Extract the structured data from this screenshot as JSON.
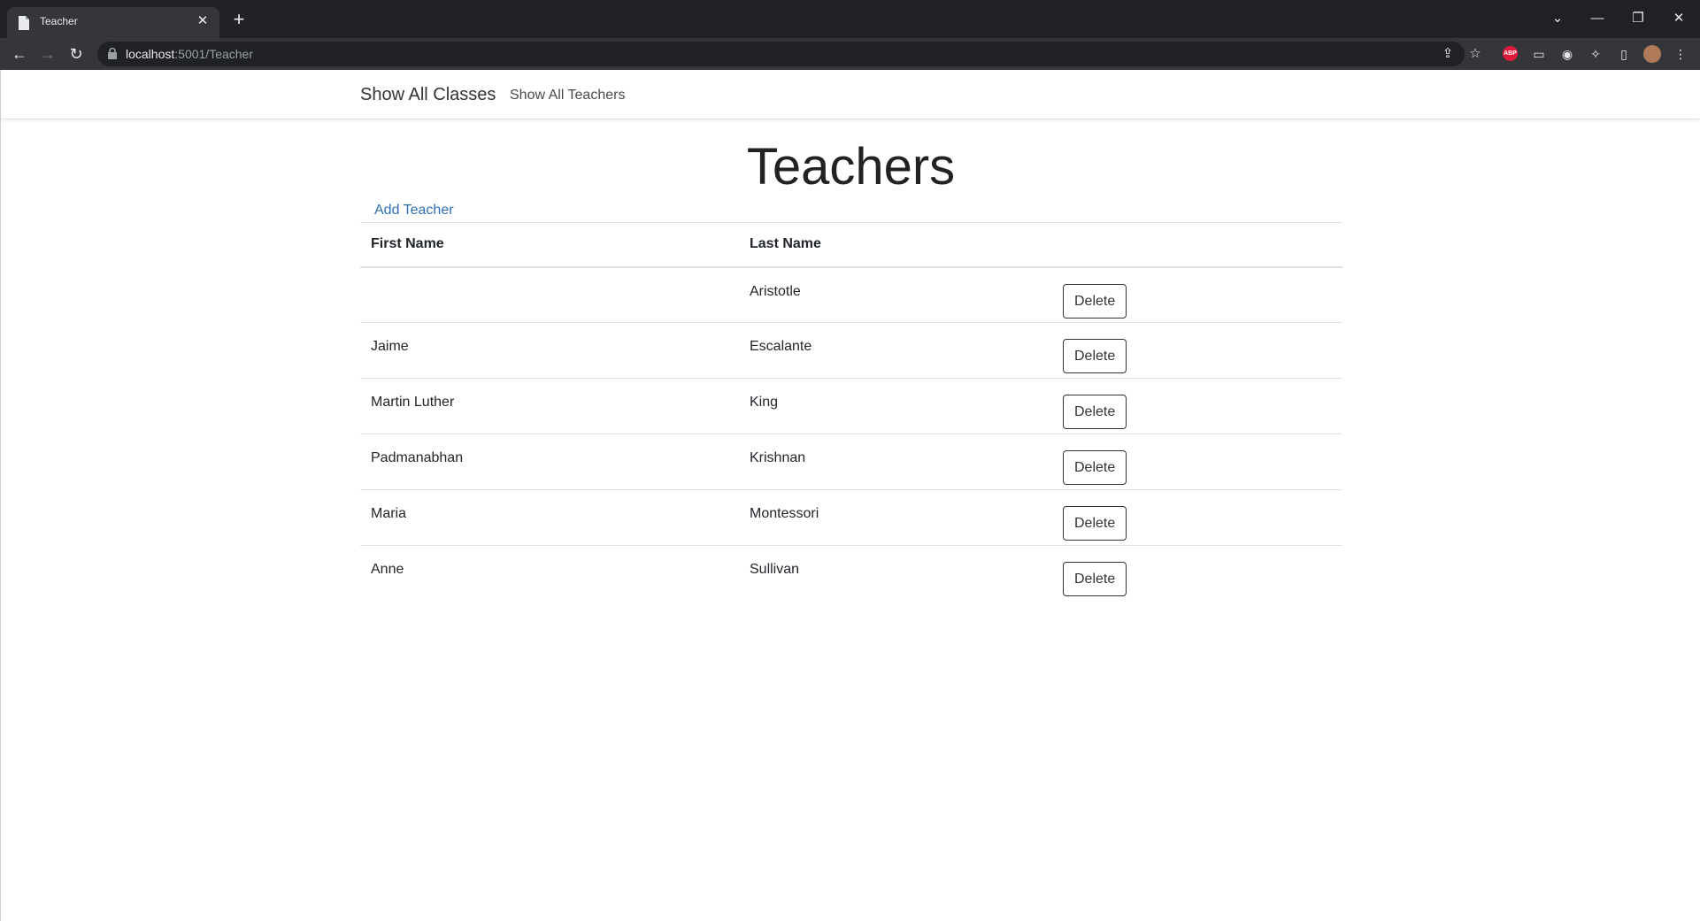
{
  "browser": {
    "tab_title": "Teacher",
    "tab_close": "✕",
    "new_tab": "+",
    "url_host": "localhost",
    "url_path": ":5001/Teacher",
    "icons": {
      "back": "←",
      "forward": "→",
      "reload": "↻",
      "share": "⇪",
      "star": "☆",
      "abp": "ABP",
      "reader": "▭",
      "extensions": "✧",
      "sidepanel": "▯",
      "menu": "⋮",
      "minimize": "—",
      "restore": "❐",
      "close": "✕",
      "tab_search": "⌄"
    }
  },
  "nav": {
    "brand": "Show All Classes",
    "link": "Show All Teachers"
  },
  "main": {
    "title": "Teachers",
    "add_link": "Add Teacher",
    "columns": [
      "First Name",
      "Last Name"
    ],
    "delete_label": "Delete",
    "rows": [
      {
        "first": "",
        "last": "Aristotle"
      },
      {
        "first": "Jaime",
        "last": "Escalante"
      },
      {
        "first": "Martin Luther",
        "last": "King"
      },
      {
        "first": "Padmanabhan",
        "last": "Krishnan"
      },
      {
        "first": "Maria",
        "last": "Montessori"
      },
      {
        "first": "Anne",
        "last": "Sullivan"
      }
    ]
  },
  "colors": {
    "link": "#2f6fb5",
    "chrome_dark": "#202124",
    "chrome_toolbar": "#35363a"
  }
}
